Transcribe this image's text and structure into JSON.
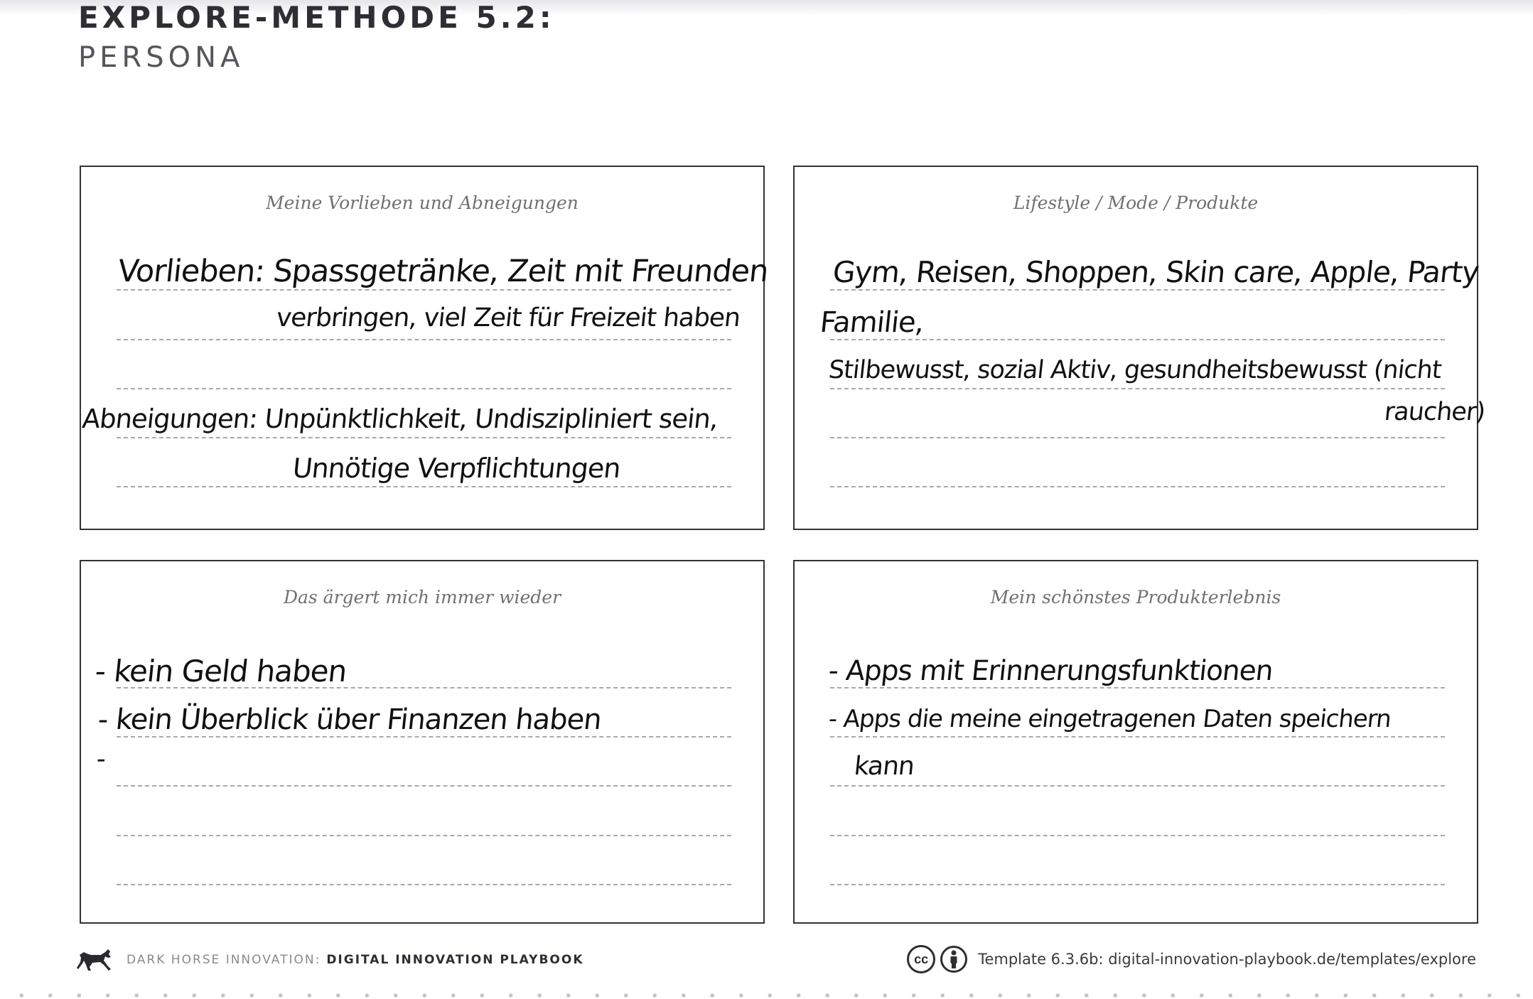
{
  "header": {
    "title": "EXPLORE-METHODE 5.2:",
    "subtitle": "PERSONA"
  },
  "cards": {
    "preferences": {
      "heading": "Meine Vorlieben und Abneigungen",
      "lines": [
        "Vorlieben: Spassgetränke, Zeit mit Freunden",
        "verbringen, viel Zeit für Freizeit haben",
        "Abneigungen: Unpünktlichkeit, Undiszipliniert sein,",
        "Unnötige Verpflichtungen"
      ]
    },
    "lifestyle": {
      "heading": "Lifestyle / Mode / Produkte",
      "lines": [
        "Gym, Reisen, Shoppen, Skin care, Apple, Party",
        "Familie,",
        "Stilbewusst, sozial Aktiv, gesundheitsbewusst (nicht",
        "raucher)"
      ]
    },
    "annoyances": {
      "heading": "Das ärgert mich immer wieder",
      "lines": [
        "- kein Geld haben",
        "- kein Überblick über Finanzen haben",
        "-"
      ]
    },
    "best_experience": {
      "heading": "Mein schönstes Produkterlebnis",
      "lines": [
        "- Apps mit Erinnerungsfunktionen",
        "- Apps die meine eingetragenen Daten speichern",
        "kann"
      ]
    }
  },
  "footer": {
    "brand": "DARK HORSE INNOVATION:",
    "product": "DIGITAL INNOVATION PLAYBOOK",
    "license_icon": "cc-by-icon",
    "template_ref": "Template 6.3.6b: digital-innovation-playbook.de/templates/explore"
  }
}
